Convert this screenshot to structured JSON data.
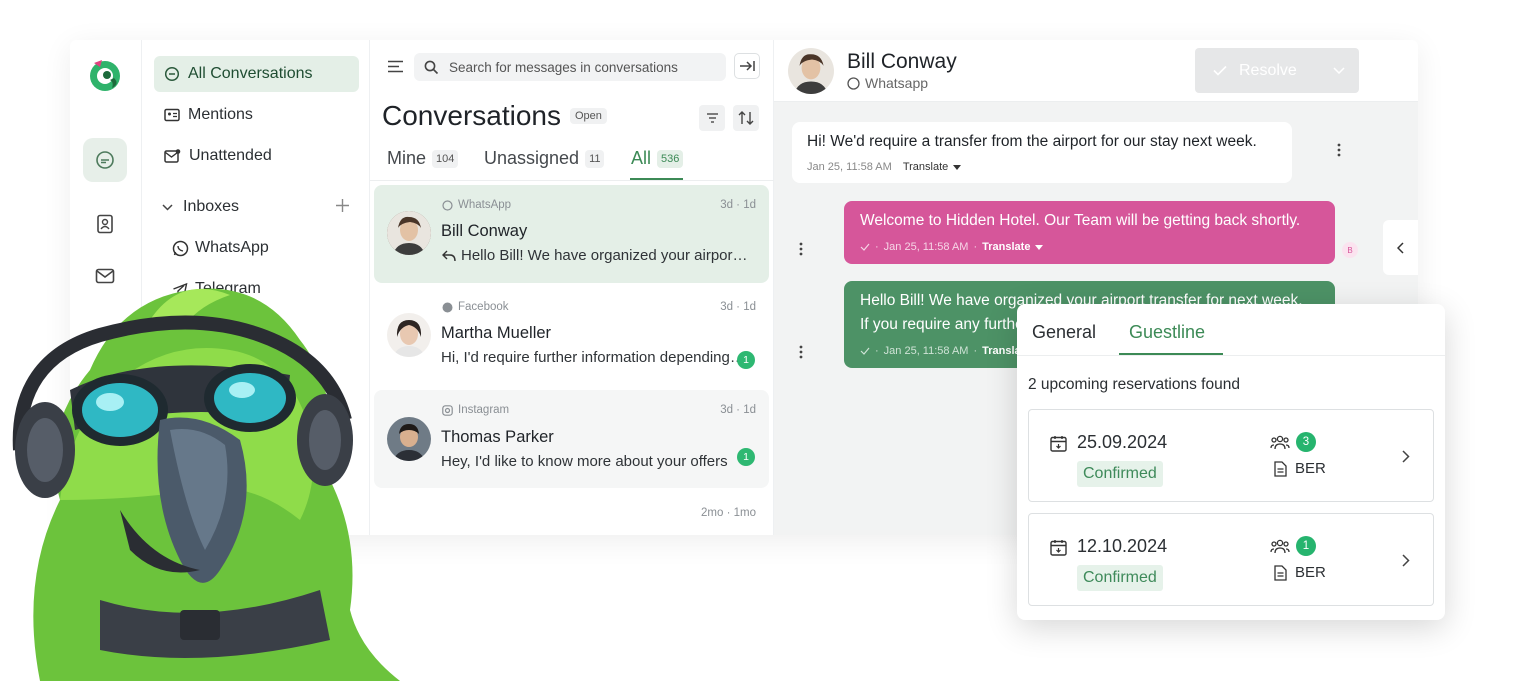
{
  "nav": {
    "items": [
      {
        "label": "All Conversations"
      },
      {
        "label": "Mentions"
      },
      {
        "label": "Unattended"
      }
    ],
    "inboxes_label": "Inboxes",
    "inbox_items": [
      {
        "label": "WhatsApp"
      },
      {
        "label": "Telegram"
      }
    ]
  },
  "list": {
    "search_placeholder": "Search for messages in conversations",
    "title": "Conversations",
    "status_badge": "Open",
    "tabs": [
      {
        "label": "Mine",
        "count": "104"
      },
      {
        "label": "Unassigned",
        "count": "11"
      },
      {
        "label": "All",
        "count": "536"
      }
    ],
    "conversations": [
      {
        "source": "WhatsApp",
        "time": "3d · 1d",
        "name": "Bill Conway",
        "message": "Hello Bill! We have organized your airport transfer for next week",
        "unread": ""
      },
      {
        "source": "Facebook",
        "time": "3d · 1d",
        "name": "Martha Mueller",
        "message": "Hi, I'd require further information depending on the room",
        "unread": "1"
      },
      {
        "source": "Instagram",
        "time": "3d · 1d",
        "name": "Thomas Parker",
        "message": "Hey, I'd like to know more about your offers",
        "unread": "1"
      },
      {
        "source": "",
        "time": "2mo · 1mo",
        "name": "",
        "message": "",
        "unread": ""
      }
    ]
  },
  "chat": {
    "contact_name": "Bill Conway",
    "contact_channel": "Whatsapp",
    "resolve_label": "Resolve",
    "messages": [
      {
        "text": "Hi! We'd require a transfer from the airport for our stay next week.",
        "timestamp": "Jan 25, 11:58 AM",
        "translate": "Translate"
      },
      {
        "text": "Welcome to Hidden Hotel. Our Team will be getting back shortly.",
        "timestamp": "Jan 25, 11:58 AM",
        "translate": "Translate"
      },
      {
        "text_line1": "Hello Bill! We have organized your airport transfer for next week.",
        "text_line2": "If you require any further assistance, please let us know.",
        "timestamp": "Jan 25, 11:58 AM",
        "translate": "Translate"
      }
    ],
    "bot_badge": "B"
  },
  "guestline": {
    "tabs": [
      {
        "label": "General"
      },
      {
        "label": "Guestline"
      }
    ],
    "summary": "2 upcoming reservations found",
    "reservations": [
      {
        "date": "25.09.2024",
        "status": "Confirmed",
        "guests": "3",
        "property": "BER"
      },
      {
        "date": "12.10.2024",
        "status": "Confirmed",
        "guests": "1",
        "property": "BER"
      }
    ]
  },
  "colors": {
    "brand_green": "#4a8a5c",
    "accent_green": "#26b46e",
    "bot_pink": "#d6569a",
    "outgoing_green": "#4d9266",
    "active_nav_bg": "#e4efe7"
  }
}
